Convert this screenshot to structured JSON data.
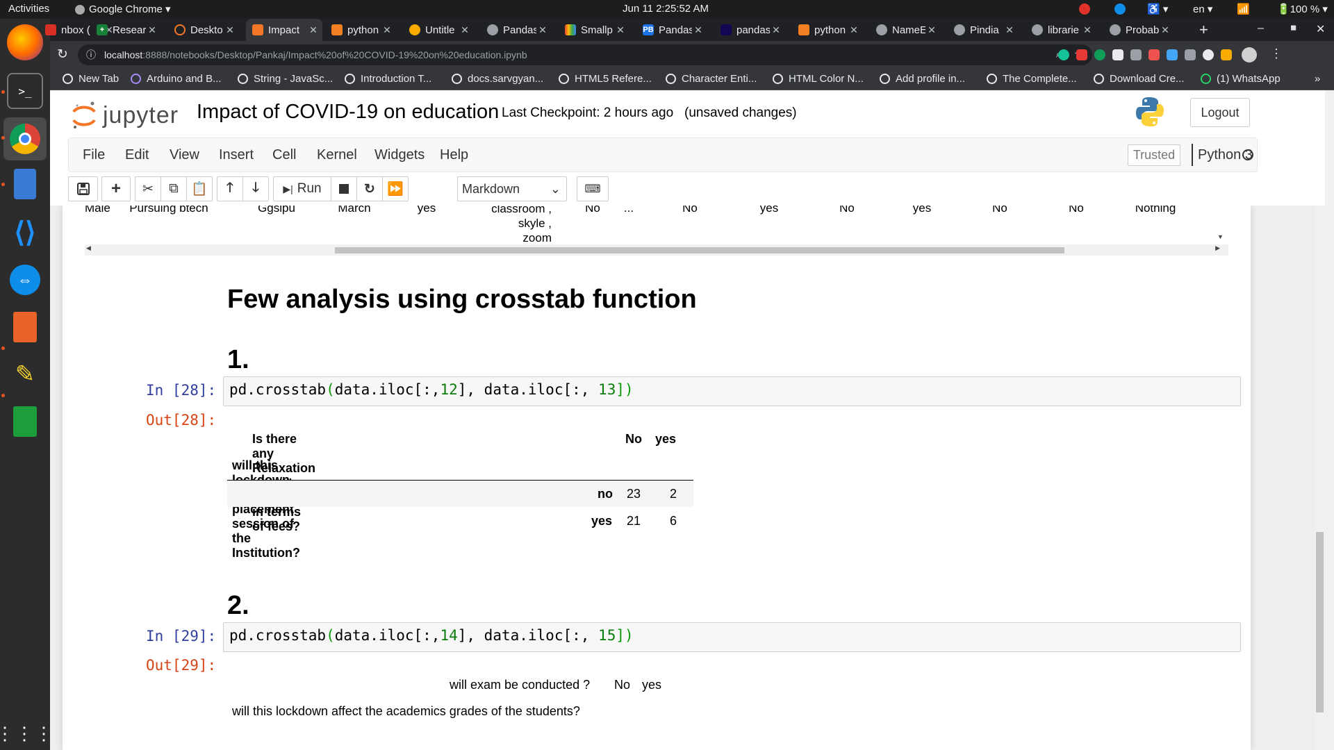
{
  "topbar": {
    "activities": "Activities",
    "app_name": "Google Chrome",
    "clock": "Jun 11  2:25:52 AM",
    "language": "en",
    "battery": "100 %"
  },
  "tabs": [
    {
      "title": "nbox (",
      "favicon_color": "#d93025"
    },
    {
      "title": "Researc",
      "favicon_color": "#188038"
    },
    {
      "title": "Deskto",
      "favicon_color": "#f37726"
    },
    {
      "title": "Impact",
      "favicon_color": "#f37726"
    },
    {
      "title": "python",
      "favicon_color": "#f48024"
    },
    {
      "title": "Untitle",
      "favicon_color": "#f9ab00"
    },
    {
      "title": "Pandas",
      "favicon_color": "#9aa0a6"
    },
    {
      "title": "Smallp",
      "favicon_color": "#a142f4"
    },
    {
      "title": "Pandas",
      "favicon_color": "#1a73e8"
    },
    {
      "title": "pandas",
      "favicon_color": "#130754"
    },
    {
      "title": "python",
      "favicon_color": "#f48024"
    },
    {
      "title": "NameE",
      "favicon_color": "#9aa0a6"
    },
    {
      "title": "Pindia",
      "favicon_color": "#9aa0a6"
    },
    {
      "title": "librarie",
      "favicon_color": "#9aa0a6"
    },
    {
      "title": "Probab",
      "favicon_color": "#9aa0a6"
    }
  ],
  "new_tab_symbol": "+",
  "omnibox": {
    "host": "localhost",
    "path": ":8888/notebooks/Desktop/Pankaj/Impact%20of%20COVID-19%20on%20education.ipynb"
  },
  "bookmarks": [
    "New Tab",
    "Arduino and B...",
    "String - JavaSc...",
    "Introduction T...",
    "docs.sarvgyan...",
    "HTML5 Refere...",
    "Character Enti...",
    "HTML Color N...",
    "Add profile in...",
    "The Complete...",
    "Download Cre...",
    "(1) WhatsApp"
  ],
  "bookmarks_overflow": "»",
  "jupyter": {
    "logo_text": "jupyter",
    "notebook_title": "Impact of COVID-19 on education",
    "checkpoint": "Last Checkpoint: 2 hours ago",
    "unsaved": "(unsaved changes)",
    "logout": "Logout",
    "menu": [
      "File",
      "Edit",
      "View",
      "Insert",
      "Cell",
      "Kernel",
      "Widgets",
      "Help"
    ],
    "trusted": "Trusted",
    "kernel": "Python 3",
    "run_label": "Run",
    "cell_type": "Markdown"
  },
  "df_remnant": {
    "cells": [
      "Male",
      "Pursuing btech",
      "Ggsipu",
      "March",
      "yes",
      "classroom ,\nskyle ,\nzoom",
      "No",
      "...",
      "No",
      "yes",
      "No",
      "yes",
      "No",
      "No",
      "Nothing"
    ]
  },
  "notebook": {
    "heading_main": "Few analysis using crosstab function",
    "heading_1": "1.",
    "heading_2": "2.",
    "cell28": {
      "in_prompt": "In [28]:",
      "out_prompt": "Out[28]:",
      "code_a": "pd.crosstab",
      "code_b": "(",
      "code_c": "data.iloc[:,",
      "code_d": "12",
      "code_e": "], data.iloc[:, ",
      "code_f": "13",
      "code_g": "])",
      "col_header": "Is there any Relaxation given to students in terms of fees?",
      "col_no": "No",
      "col_yes": "yes",
      "row_header": "will this lockdown affect the placement session of the Institution?",
      "rows": [
        {
          "label": "no",
          "no": "23",
          "yes": "2"
        },
        {
          "label": "yes",
          "no": "21",
          "yes": "6"
        }
      ]
    },
    "cell29": {
      "in_prompt": "In [29]:",
      "out_prompt": "Out[29]:",
      "code_a": "pd.crosstab",
      "code_b": "(",
      "code_c": "data.iloc[:,",
      "code_d": "14",
      "code_e": "], data.iloc[:, ",
      "code_f": "15",
      "code_g": "])",
      "col_header": "will exam be conducted ?",
      "col_no": "No",
      "col_yes": "yes",
      "row_header": "will this lockdown affect the academics grades of the students?"
    }
  }
}
